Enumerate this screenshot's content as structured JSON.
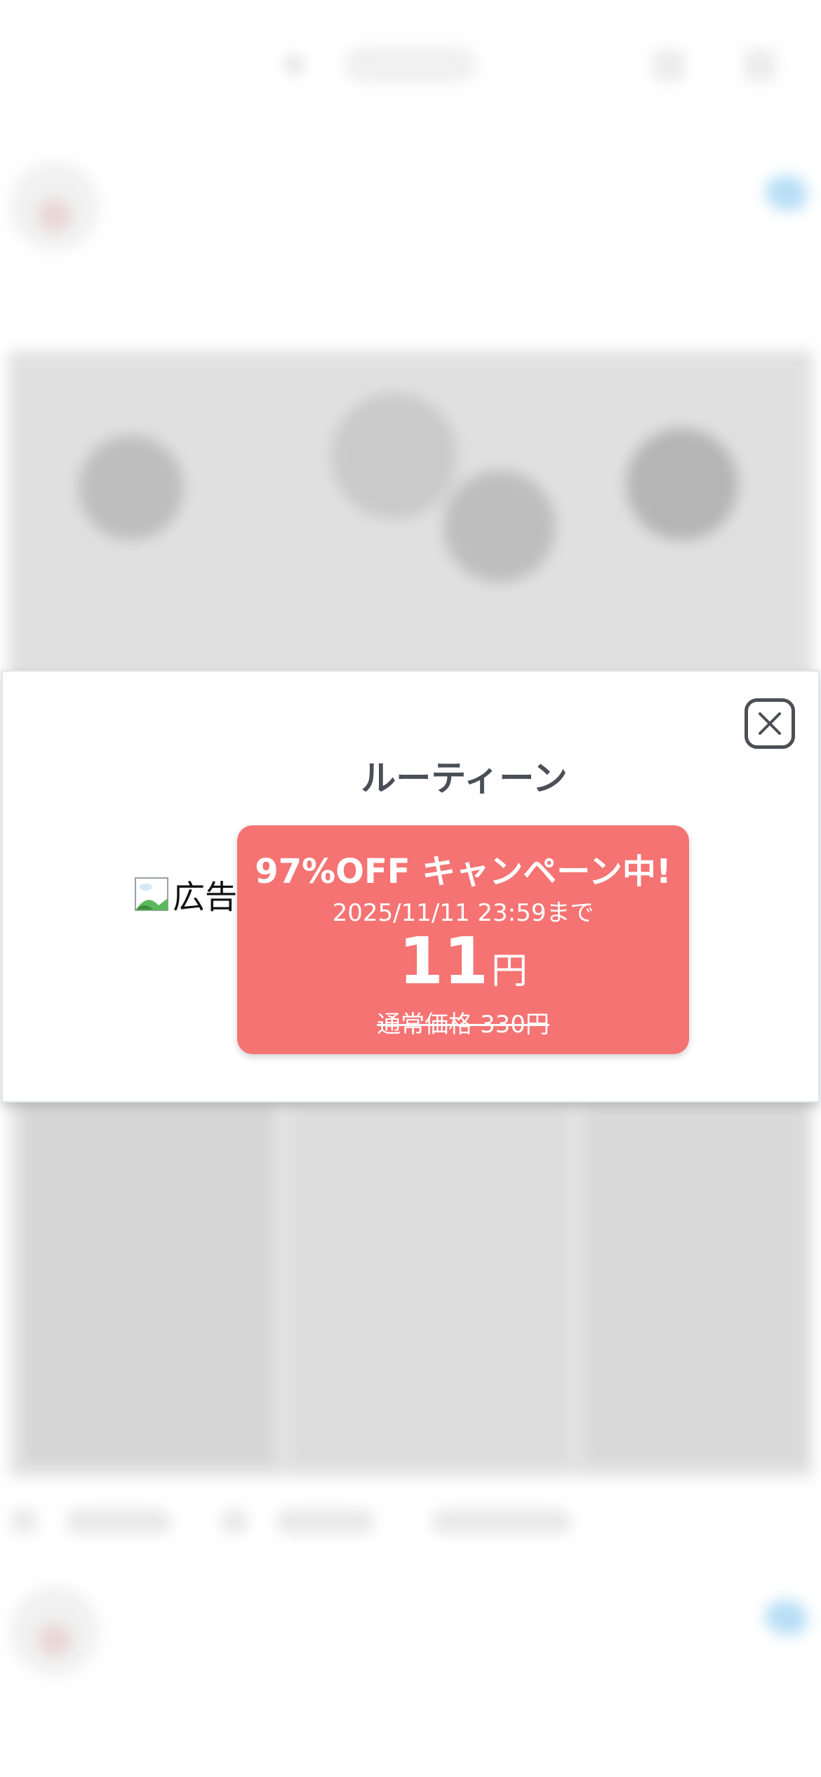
{
  "background": {
    "header": {
      "logo_text": ""
    },
    "posts": [
      {
        "name": "",
        "handle": "",
        "text": ""
      },
      {
        "name": "",
        "handle": "",
        "text": ""
      }
    ]
  },
  "modal": {
    "close_icon": "close-icon",
    "title": "ルーティーン",
    "broken_image_alt": "広告",
    "promo": {
      "headline": "97%OFF キャンペーン中!",
      "deadline": "2025/11/11 23:59まで",
      "price_value": "11",
      "price_unit": "円",
      "regular_price": "通常価格 330円",
      "color": "#f57373"
    }
  }
}
